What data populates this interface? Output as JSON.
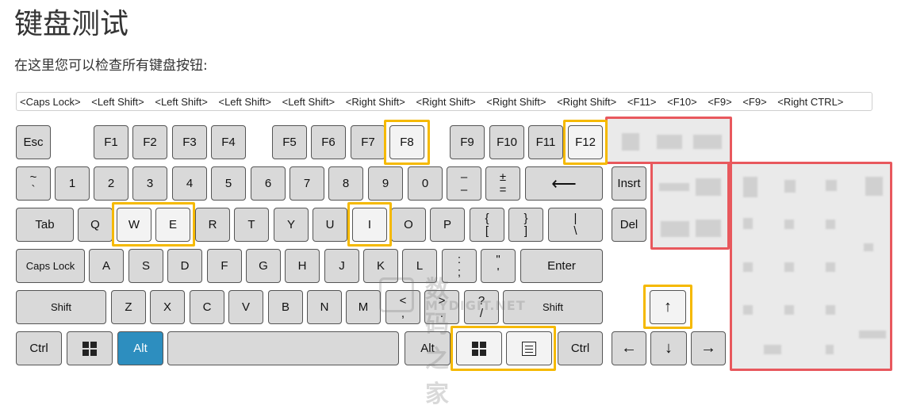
{
  "page": {
    "title": "键盘测试",
    "subtitle": "在这里您可以检查所有键盘按钮:"
  },
  "log": [
    "<Caps Lock>",
    "<Left Shift>",
    "<Left Shift>",
    "<Left Shift>",
    "<Left Shift>",
    "<Right Shift>",
    "<Right Shift>",
    "<Right Shift>",
    "<Right Shift>",
    "<F11>",
    "<F10>",
    "<F9>",
    "<F9>",
    "<Right CTRL>"
  ],
  "keys": {
    "esc": "Esc",
    "f1": "F1",
    "f2": "F2",
    "f3": "F3",
    "f4": "F4",
    "f5": "F5",
    "f6": "F6",
    "f7": "F7",
    "f8": "F8",
    "f9": "F9",
    "f10": "F10",
    "f11": "F11",
    "f12": "F12",
    "tilde_top": "~",
    "tilde_bottom": "`",
    "n1": "1",
    "n2": "2",
    "n3": "3",
    "n4": "4",
    "n5": "5",
    "n6": "6",
    "n7": "7",
    "n8": "8",
    "n9": "9",
    "n0": "0",
    "minus_top": "–",
    "minus_bottom": "–",
    "plus_top": "±",
    "plus_bottom": "=",
    "backspace": "⟵",
    "insert": "Insrt",
    "tab": "Tab",
    "q": "Q",
    "w": "W",
    "e": "E",
    "r": "R",
    "t": "T",
    "y": "Y",
    "u": "U",
    "i": "I",
    "o": "O",
    "p": "P",
    "lbrace_top": "{",
    "lbrace_bottom": "[",
    "rbrace_top": "}",
    "rbrace_bottom": "]",
    "pipe_top": "|",
    "pipe_bottom": "\\",
    "delete": "Del",
    "capslock": "Caps Lock",
    "a": "A",
    "s": "S",
    "d": "D",
    "f": "F",
    "g": "G",
    "h": "H",
    "j": "J",
    "k": "K",
    "l": "L",
    "colon_top": ":",
    "colon_bottom": ";",
    "quote_top": "\"",
    "quote_bottom": "'",
    "enter": "Enter",
    "lshift": "Shift",
    "z": "Z",
    "x": "X",
    "c": "C",
    "v": "V",
    "b": "B",
    "n": "N",
    "m": "M",
    "lt_top": "<",
    "lt_bottom": ",",
    "gt_top": ">",
    "gt_bottom": ".",
    "q_top": "?",
    "q_bottom": "/",
    "rshift": "Shift",
    "up": "↑",
    "lctrl": "Ctrl",
    "lalt": "Alt",
    "ralt": "Alt",
    "rctrl": "Ctrl",
    "left": "←",
    "down": "↓",
    "right": "→"
  },
  "watermark": {
    "text": "数码之家",
    "sub": "MYDIGIT.NET"
  },
  "colors": {
    "highlight": "#f5b900",
    "redacted": "#e8585d",
    "active_key": "#2d8ebf"
  }
}
